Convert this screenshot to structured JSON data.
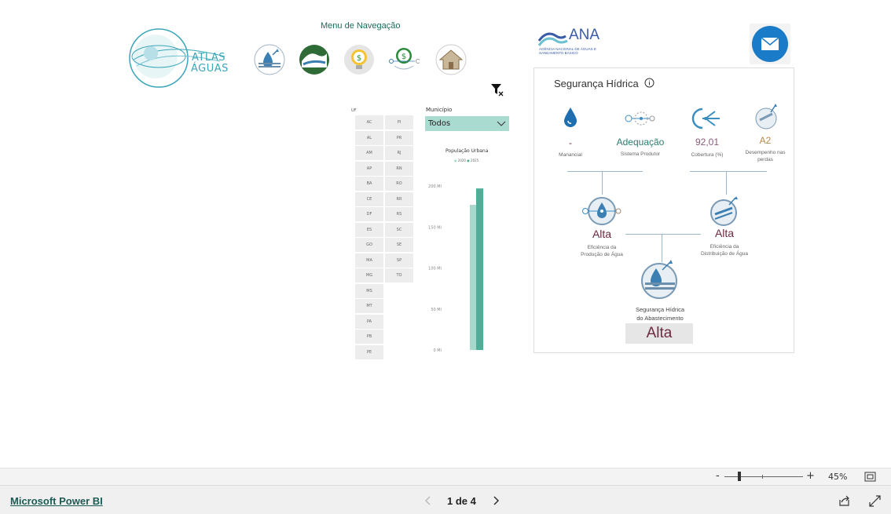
{
  "header": {
    "logo_line1": "ATLAS",
    "logo_line2": "ÁGUAS",
    "nav_title": "Menu de Navegação",
    "nav_icons": [
      "water-security-icon",
      "landscape-icon",
      "lightbulb-money-icon",
      "money-network-icon",
      "house-icon"
    ],
    "ana_name": "ANA",
    "ana_subtitle": "AGÊNCIA NACIONAL DE ÁGUAS E SANEAMENTO BÁSICO",
    "mail_icon": "mail-icon",
    "clear_filter_icon": "clear-filter-icon"
  },
  "uf_slicer": {
    "label": "UF",
    "col1": [
      "AC",
      "AL",
      "AM",
      "AP",
      "BA",
      "CE",
      "DF",
      "ES",
      "GO",
      "MA",
      "MG",
      "MS",
      "MT",
      "PA",
      "PB",
      "PE"
    ],
    "col2": [
      "PI",
      "PR",
      "RJ",
      "RN",
      "RO",
      "RR",
      "RS",
      "SC",
      "SE",
      "SP",
      "TO"
    ]
  },
  "municipio": {
    "label": "Município",
    "value": "Todos"
  },
  "chart_data": {
    "type": "bar",
    "title": "População Urbana",
    "categories": [
      ""
    ],
    "series": [
      {
        "name": "2020",
        "values": [
          177
        ],
        "color": "#a6d8cc"
      },
      {
        "name": "2025",
        "values": [
          197
        ],
        "color": "#4fae96"
      }
    ],
    "yticks": [
      "0 Mi",
      "50 Mi",
      "100 Mi",
      "150 Mi",
      "200 Mi"
    ],
    "ylim": [
      0,
      200
    ]
  },
  "panel": {
    "title": "Segurança Hídrica",
    "manancial_value": "-",
    "manancial_label": "Manancial",
    "adequacao_value": "Adequação",
    "adequacao_label": "Sistema Produtor",
    "cobertura_value": "92,01",
    "cobertura_label": "Cobertura (%)",
    "perdas_value": "A2",
    "perdas_label1": "Desempenho nas",
    "perdas_label2": "perdas",
    "producao_value": "Alta",
    "producao_label1": "Eficiência da",
    "producao_label2": "Produção de Água",
    "distribuicao_value": "Alta",
    "distribuicao_label1": "Eficiência da",
    "distribuicao_label2": "Distribuição de Água",
    "abastecimento_label1": "Segurança Hídrica",
    "abastecimento_label2": "do Abastecimento",
    "abastecimento_value": "Alta",
    "colors": {
      "dark_red": "#6b2a3f",
      "teal": "#2a7d6f",
      "purple": "#8a5a7a",
      "gold": "#b8864a"
    }
  },
  "zoombar": {
    "minus": "-",
    "plus": "+",
    "zoom": "45%"
  },
  "footer": {
    "link": "Microsoft Power BI",
    "page": "1 de 4"
  }
}
